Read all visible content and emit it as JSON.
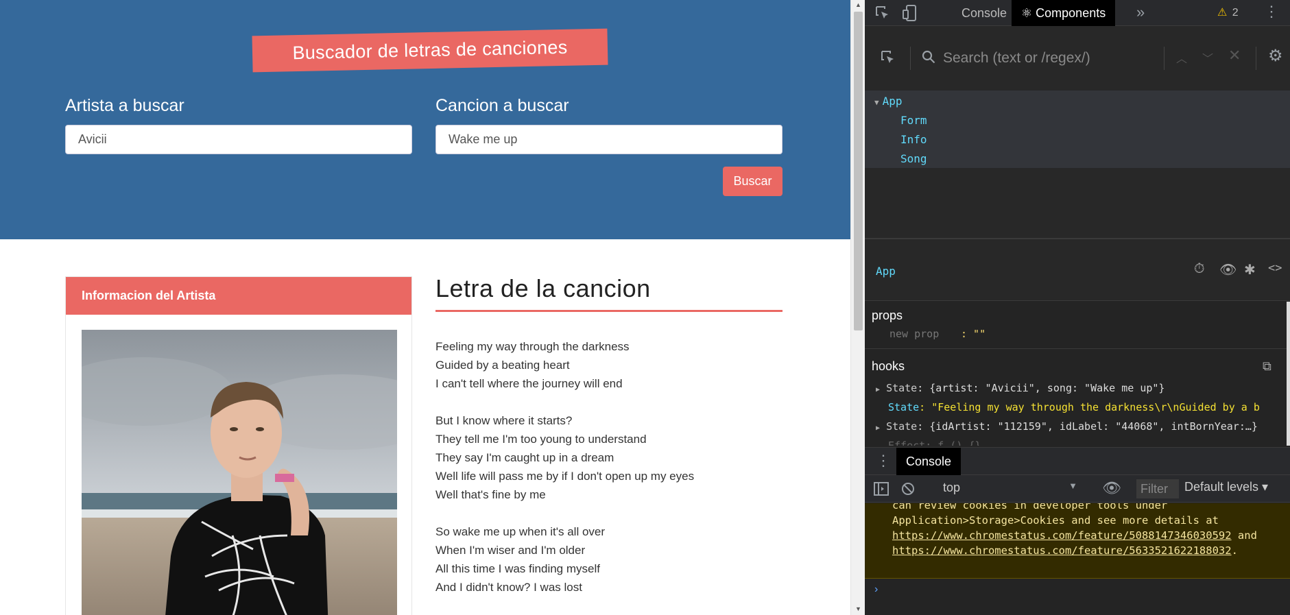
{
  "app": {
    "title": "Buscador de letras de canciones",
    "artist_label": "Artista a buscar",
    "artist_value": "Avicii",
    "song_label": "Cancion a buscar",
    "song_value": "Wake me up",
    "search_button": "Buscar",
    "artist_card_title": "Informacion del Artista",
    "lyrics_title": "Letra de la cancion",
    "lyrics_stanzas": [
      [
        "Feeling my way through the darkness",
        "Guided by a beating heart",
        "I can't tell where the journey will end"
      ],
      [
        "But I know where it starts?",
        "They tell me I'm too young to understand",
        "They say I'm caught up in a dream",
        "Well life will pass me by if I don't open up my eyes",
        "Well that's fine by me"
      ],
      [
        "So wake me up when it's all over",
        "When I'm wiser and I'm older",
        "All this time I was finding myself",
        "And I didn't know? I was lost"
      ]
    ],
    "colors": {
      "hero": "#35699b",
      "accent": "#ea6863"
    }
  },
  "devtools": {
    "tabs": {
      "console": "Console",
      "components": "Components"
    },
    "warning_count": "2",
    "search_placeholder": "Search (text or /regex/)",
    "tree": [
      "App",
      "Form",
      "Info",
      "Song"
    ],
    "selected": "App",
    "props": {
      "title": "props",
      "new_prop": "new prop",
      "new_prop_value": ": \"\""
    },
    "hooks": {
      "title": "hooks",
      "rows": [
        {
          "label": "State",
          "value": ": {artist: \"Avicii\", song: \"Wake me up\"}"
        },
        {
          "label": "State",
          "value": ": \"Feeling my way through the darkness\\r\\nGuided by a b"
        },
        {
          "label": "State",
          "value": ": {idArtist: \"112159\", idLabel: \"44068\", intBornYear:…}"
        },
        {
          "label": "Effect",
          "value": ": f () {}"
        }
      ]
    },
    "drawer": {
      "tab": "Console",
      "context": "top",
      "filter": "Filter",
      "levels": "Default levels ▾",
      "message_lines": [
        "can review cookies in developer tools under",
        "Application>Storage>Cookies and see more details at "
      ],
      "link1": "https://www.chromestatus.com/feature/5088147346030592",
      "and_text": " and ",
      "link2": "https://www.chromestatus.com/feature/5633521622188032",
      "prompt": "›"
    }
  }
}
